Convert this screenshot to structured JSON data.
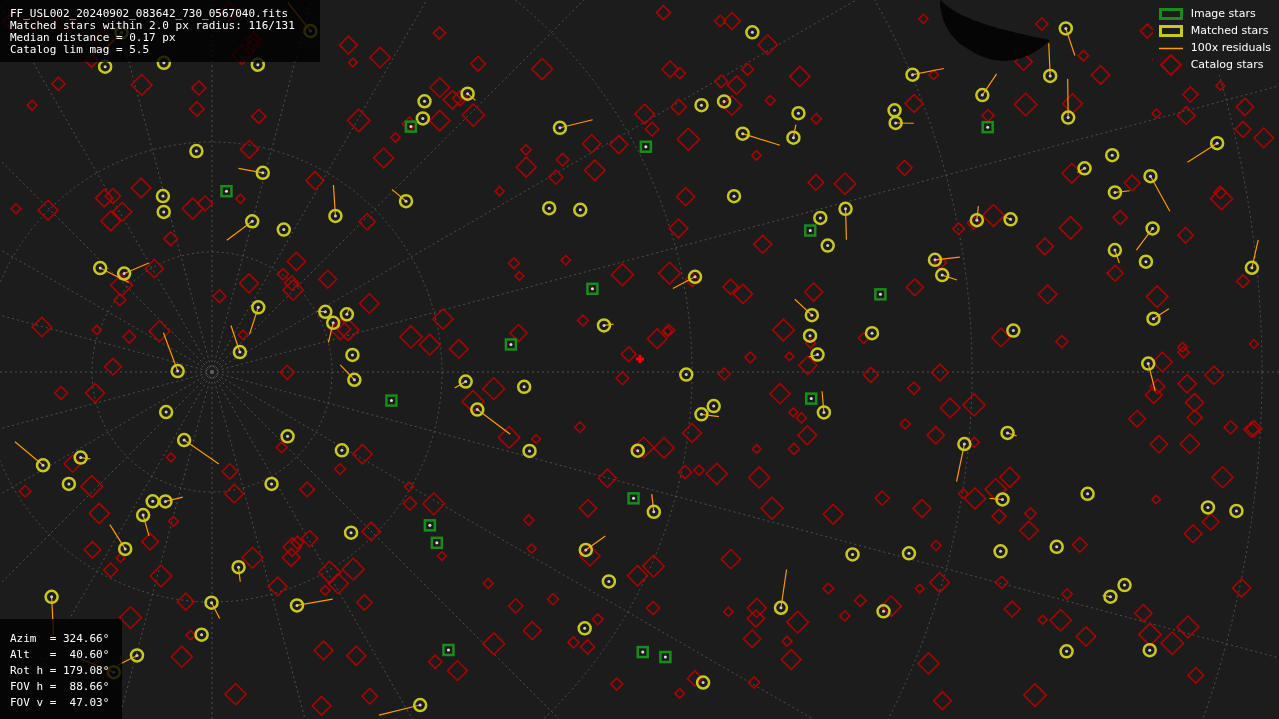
{
  "header": {
    "lines": [
      "FF_USL002_20240902_083642_730_0567040.fits",
      "Matched stars within 2.0 px radius: 116/131",
      "Median distance = 0.17 px",
      "Catalog lim mag = 5.5"
    ]
  },
  "pointing": {
    "lines": [
      "Azim  = 324.66°",
      "Alt   =  40.60°",
      "Rot h = 179.08°",
      "FOV h =  88.66°",
      "FOV v =  47.03°"
    ]
  },
  "legend": [
    {
      "kind": "image",
      "label": "Image stars",
      "color": "#1a8c1a"
    },
    {
      "kind": "matched",
      "label": "Matched stars",
      "color": "#c8c820"
    },
    {
      "kind": "residual",
      "label": "100x residuals",
      "color": "#ff9900"
    },
    {
      "kind": "catalog",
      "label": "Catalog stars",
      "color": "#aa0000"
    }
  ]
}
